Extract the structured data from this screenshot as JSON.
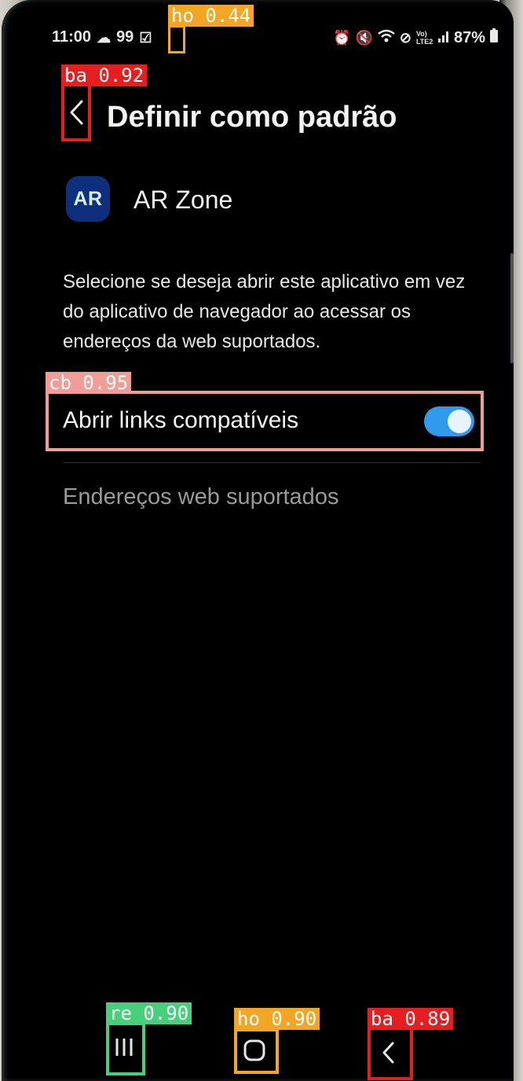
{
  "status_bar": {
    "time": "11:00",
    "cloud_icon": "cloud-icon",
    "notif_count": "99",
    "check_icon": "checkbox-icon",
    "right_icons": [
      "alarm-icon",
      "mute-icon",
      "wifi-icon",
      "dnd-icon"
    ],
    "volte": "Vo) LTE2",
    "battery": "87%"
  },
  "header": {
    "title": "Definir como padrão",
    "back_icon": "back-arrow-icon"
  },
  "app": {
    "icon_text": "AR",
    "name": "AR Zone"
  },
  "description": "Selecione se deseja abrir este aplicativo em vez do aplicativo de navegador ao acessar os endereços da web suportados.",
  "toggle": {
    "label": "Abrir links compatíveis",
    "on": true
  },
  "supported_addresses_label": "Endereços web suportados",
  "navbar": {
    "recents_icon": "recents-icon",
    "home_icon": "home-icon",
    "back_icon": "back-icon"
  },
  "detections": [
    {
      "tag": "ho 0.44"
    },
    {
      "tag": "ba 0.92"
    },
    {
      "tag": "cb 0.95"
    },
    {
      "tag": "re 0.90"
    },
    {
      "tag": "ho 0.90"
    },
    {
      "tag": "ba 0.89"
    }
  ],
  "colors": {
    "accent_toggle": "#2f9bea",
    "box_back": "#e51f1f",
    "box_home": "#f3a626",
    "box_checkbox": "#f09d98",
    "box_recents": "#46d07b"
  }
}
